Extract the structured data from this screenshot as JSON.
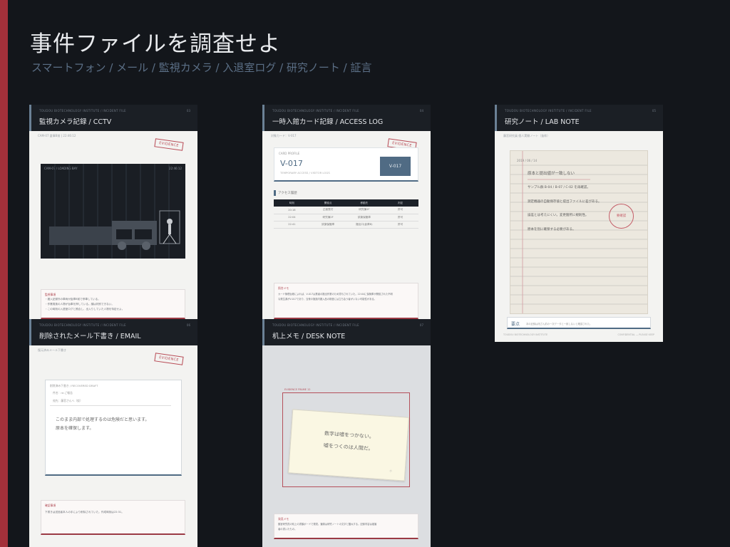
{
  "slide": {
    "title": "事件ファイルを調査せよ",
    "subtitle": "スマートフォン / メール / 監視カメラ / 入退室ログ / 研究ノート / 証言"
  },
  "cards": {
    "cctv": {
      "meta": "TOUDOU BIOTECHNOLOGY INSTITUTE / INCIDENT FILE",
      "num": "03",
      "name": "監視カメラ記録 / CCTV",
      "caption": "CAM-07 倉庫B前 | 22:46:12",
      "stamp": "EVIDENCE",
      "cam_label": "CAM-07 / LOADING BAY",
      "cam_time": "22:46:12",
      "memo_title": "監視事項",
      "memo_lines": [
        "・搬入記録外の車両が倉庫B前で停車している。",
        "・作業員風の人物が台車を押している。顔は判別できない。",
        "・この時刻の入退室ログと照合し、出入りしていた人物を特定せよ。"
      ]
    },
    "access": {
      "meta": "TOUDOU BIOTECHNOLOGY INSTITUTE / INCIDENT FILE",
      "num": "04",
      "name": "一時入館カード記録 / ACCESS LOG",
      "caption": "対象カード：V-017",
      "stamp": "EVIDENCE",
      "card_label": "CARD PROFILE",
      "card_id": "V-017",
      "card_sub": "TEMPORARY ACCESS / VISITOR LOGS",
      "badge": "V-017",
      "section": "アクセス履歴",
      "table_head": [
        "時刻",
        "開錠点",
        "移動先",
        "判定"
      ],
      "table_rows": [
        [
          "20:18",
          "正面受付",
          "研究棟2F",
          "許可"
        ],
        [
          "22:04",
          "研究棟2F",
          "試薬保管庫",
          "許可"
        ],
        [
          "22:41",
          "試薬保管庫",
          "搬出口(倉庫B)",
          "許可"
        ]
      ],
      "memo_title": "照合メモ",
      "memo_lines": [
        "カード管理台帳によれば、V-017は業者の搬出作業のため貸与されていた。22:04に保管庫が開錠された不明",
        "な発生源がV-017であり、当夜の施設内搬入品の検査には立ち会う者がいない可能性がある。"
      ]
    },
    "labnote": {
      "meta": "TOUDOU BIOTECHNOLOGY INSTITUTE / INCIDENT FILE",
      "num": "05",
      "name": "研究ノート / LAB NOTE",
      "caption": "藤宮研究員 個人実験ノート（抜粋）",
      "date": "2019 / 06 / 14",
      "lines": [
        "原本と提出値が一致しない",
        "サンプル群 B-04 / B-07 / C-02 を再確認。",
        "測定機器の自動保存値と提出ファイルに差がある。",
        "誤差とは考えにくい。変更箇所に規則性。",
        "原本を別に確保する必要がある。"
      ],
      "seal": "要確認",
      "foot_label": "要点",
      "foot_text": "本の記録は改ざん前の一次データと一致しないと確認された。",
      "footer_left": "TOUDOU BIOTECHNOLOGY INSTITUTE",
      "footer_right": "CONFIDENTIAL — PLEASE KEEP"
    },
    "email": {
      "meta": "TOUDOU BIOTECHNOLOGY INSTITUTE / INCIDENT FILE",
      "num": "06",
      "name": "削除されたメール下書き / EMAIL",
      "caption": "復元済みメール下書き",
      "stamp": "EVIDENCE",
      "mail_meta": "削除済み下書き / RECOVERED DRAFT",
      "mail_from": "件名：re:ご報告",
      "mail_to": "宛先：藤宮さんへ（仮）",
      "mail_body_1": "このまま内部で処理するのは危険だと思います。",
      "mail_body_2": "原本を確保します。",
      "memo_title": "確認事項",
      "memo_line": "下書きは送信者本人の手により削除されていた。作成時刻は22:31。"
    },
    "desk": {
      "meta": "TOUDOU BIOTECHNOLOGY INSTITUTE / INCIDENT FILE",
      "num": "07",
      "name": "机上メモ / DESK NOTE",
      "frame_label": "EVIDENCE FRAME 12",
      "note_line_1": "数字は嘘をつかない。",
      "note_line_2": "嘘をつくのは人間だ。",
      "note_mark": "◇",
      "memo_title": "発見メモ",
      "memo_lines": [
        "藤宮研究員の机上の書類ボードで発見。筆跡は研究ノートの文字と酷似する。記録内容は被害",
        "者の書いたもの。"
      ]
    }
  }
}
